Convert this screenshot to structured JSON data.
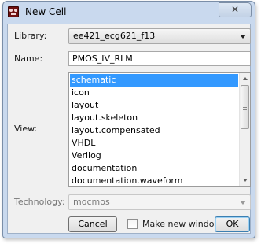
{
  "window": {
    "title": "New Cell",
    "close_glyph": "✕"
  },
  "form": {
    "library_label": "Library:",
    "library_value": "ee421_ecg621_f13",
    "name_label": "Name:",
    "name_value": "PMOS_IV_RLM",
    "view_label": "View:",
    "view_items": [
      "schematic",
      "icon",
      "layout",
      "layout.skeleton",
      "layout.compensated",
      "VHDL",
      "Verilog",
      "documentation",
      "documentation.waveform"
    ],
    "view_selected": "schematic",
    "technology_label": "Technology:",
    "technology_value": "mocmos"
  },
  "buttons": {
    "cancel_label": "Cancel",
    "new_window_label": "Make new window",
    "ok_label": "OK"
  },
  "colors": {
    "selection": "#3399ff",
    "titlebar": "#c9d9ee",
    "icon": "#6f1010"
  }
}
